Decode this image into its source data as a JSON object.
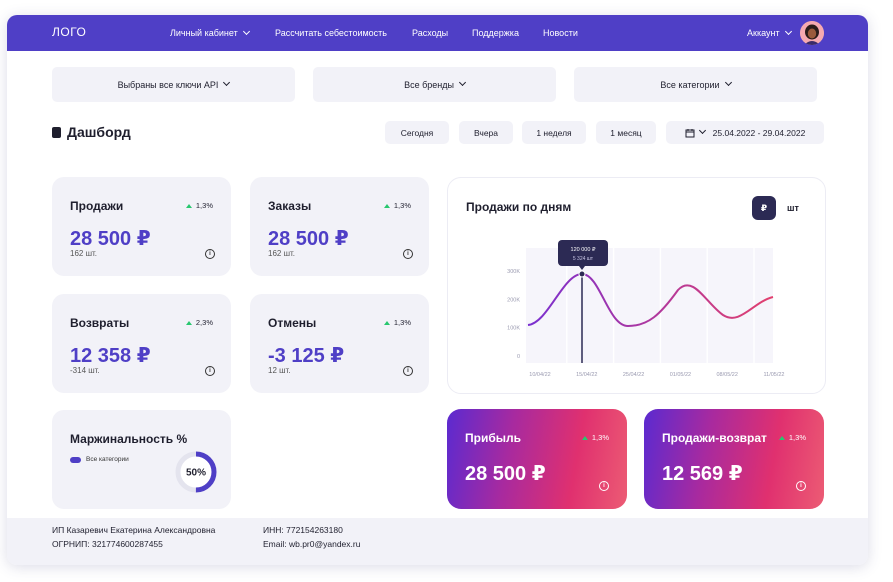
{
  "nav": {
    "logo": "ЛОГО",
    "items": [
      "Личный кабинет",
      "Рассчитать себестоимость",
      "Расходы",
      "Поддержка",
      "Новости"
    ],
    "account": "Аккаунт"
  },
  "filters": [
    "Выбраны все ключи API",
    "Все бренды",
    "Все категории"
  ],
  "dashboard": {
    "title": "Дашборд",
    "periods": [
      "Сегодня",
      "Вчера",
      "1 неделя",
      "1 месяц"
    ],
    "date_range": "25.04.2022 - 29.04.2022"
  },
  "cards": [
    {
      "name": "Продажи",
      "trend": "1,3%",
      "value": "28 500 ₽",
      "sub": "162 шт."
    },
    {
      "name": "Заказы",
      "trend": "1,3%",
      "value": "28 500 ₽",
      "sub": "162 шт."
    },
    {
      "name": "Возвраты",
      "trend": "2,3%",
      "value": "12 358 ₽",
      "sub": "-314 шт."
    },
    {
      "name": "Отмены",
      "trend": "1,3%",
      "value": "-3 125 ₽",
      "sub": "12 шт."
    }
  ],
  "margin": {
    "title": "Маржинальность %",
    "legend": "Все категории",
    "percent_label": "50%",
    "percent_value": 50
  },
  "chart_data": {
    "type": "line",
    "title": "Продажи по дням",
    "toggle": [
      "₽",
      "шт"
    ],
    "x": [
      "10/04/22",
      "15/04/22",
      "25/04/22",
      "01/05/22",
      "08/05/22",
      "11/05/22"
    ],
    "y_ticks": [
      "300K",
      "200K",
      "100K",
      "0"
    ],
    "ylim": [
      0,
      300000
    ],
    "tooltip": {
      "value": "120 000 ₽",
      "count": "5 324 шт"
    },
    "colors": {
      "start": "#7a2fd0",
      "end": "#e2406e"
    }
  },
  "bottom_cards": [
    {
      "name": "Прибыль",
      "trend": "1,3%",
      "value": "28 500 ₽"
    },
    {
      "name": "Продажи-возврат",
      "trend": "1,3%",
      "value": "12 569 ₽"
    }
  ],
  "footer": {
    "name": "ИП Казаревич Екатерина Александровна",
    "ogrnip": "ОГРНИП: 321774600287455",
    "inn": "ИНН: 772154263180",
    "email": "Email: wb.pr0@yandex.ru"
  }
}
